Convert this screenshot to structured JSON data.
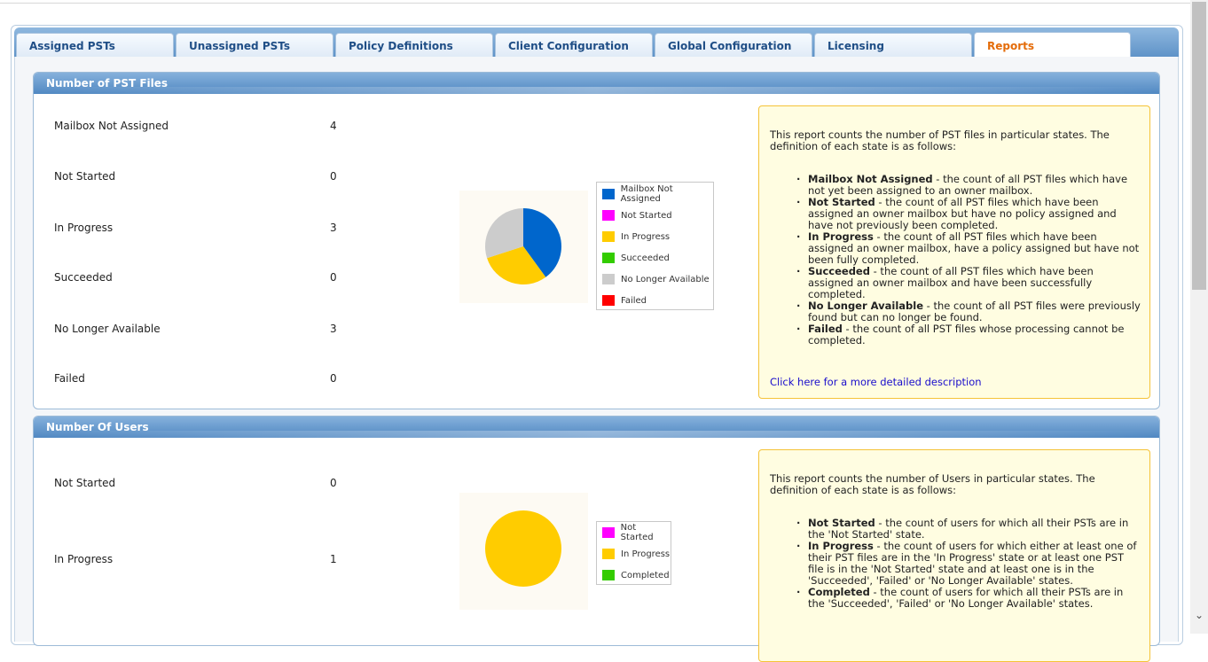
{
  "tabs": [
    {
      "label": "Assigned PSTs"
    },
    {
      "label": "Unassigned PSTs"
    },
    {
      "label": "Policy Definitions"
    },
    {
      "label": "Client Configuration"
    },
    {
      "label": "Global Configuration"
    },
    {
      "label": "Licensing"
    },
    {
      "label": "Reports",
      "active": true
    }
  ],
  "pst_panel": {
    "title": "Number of PST Files",
    "stats": [
      {
        "label": "Mailbox Not Assigned",
        "value": "4"
      },
      {
        "label": "Not Started",
        "value": "0"
      },
      {
        "label": "In Progress",
        "value": "3"
      },
      {
        "label": "Succeeded",
        "value": "0"
      },
      {
        "label": "No Longer Available",
        "value": "3"
      },
      {
        "label": "Failed",
        "value": "0"
      }
    ],
    "legend": [
      {
        "label": "Mailbox Not Assigned",
        "color": "#0066cc"
      },
      {
        "label": "Not Started",
        "color": "#ff00ff"
      },
      {
        "label": "In Progress",
        "color": "#ffcc00"
      },
      {
        "label": "Succeeded",
        "color": "#33cc00"
      },
      {
        "label": "No Longer Available",
        "color": "#cccccc"
      },
      {
        "label": "Failed",
        "color": "#ff0000"
      }
    ],
    "info": {
      "intro": "This report counts the number of PST files in particular states. The definition of each state is as follows:",
      "items": [
        {
          "term": "Mailbox Not Assigned",
          "desc": " - the count of all PST files which have not yet been assigned to an owner mailbox."
        },
        {
          "term": "Not Started",
          "desc": " - the count of all PST files which have been assigned an owner mailbox but have no policy assigned and have not previously been completed."
        },
        {
          "term": "In Progress",
          "desc": " - the count of all PST files which have been assigned an owner mailbox, have a policy assigned but have not been fully completed."
        },
        {
          "term": "Succeeded",
          "desc": " - the count of all PST files which have been assigned an owner mailbox and have been successfully completed."
        },
        {
          "term": "No Longer Available",
          "desc": " - the count of all PST files were previously found but can no longer be found."
        },
        {
          "term": "Failed",
          "desc": " - the count of all PST files whose processing cannot be completed."
        }
      ],
      "link": "Click here for a more detailed description"
    }
  },
  "users_panel": {
    "title": "Number Of Users",
    "stats": [
      {
        "label": "Not Started",
        "value": "0"
      },
      {
        "label": "In Progress",
        "value": "1"
      }
    ],
    "legend": [
      {
        "label": "Not Started",
        "color": "#ff00ff"
      },
      {
        "label": "In Progress",
        "color": "#ffcc00"
      },
      {
        "label": "Completed",
        "color": "#33cc00"
      }
    ],
    "info": {
      "intro": "This report counts the number of Users in particular states. The definition of each state is as follows:",
      "items": [
        {
          "term": "Not Started",
          "desc": " - the count of users for which all their PSTs are in the 'Not Started' state."
        },
        {
          "term": "In Progress",
          "desc": " - the count of users for which either at least one of their PST files are in the 'In Progress' state or at least one PST file is in the 'Not Started' state and at least one is in the 'Succeeded', 'Failed' or 'No Longer Available' states."
        },
        {
          "term": "Completed",
          "desc": " - the count of users for which all their PSTs are in the 'Succeeded', 'Failed' or 'No Longer Available' states."
        }
      ]
    }
  },
  "chart_data": [
    {
      "type": "pie",
      "categories": [
        "Mailbox Not Assigned",
        "Not Started",
        "In Progress",
        "Succeeded",
        "No Longer Available",
        "Failed"
      ],
      "values": [
        4,
        0,
        3,
        0,
        3,
        0
      ],
      "colors": [
        "#0066cc",
        "#ff00ff",
        "#ffcc00",
        "#33cc00",
        "#cccccc",
        "#ff0000"
      ],
      "legend": "right"
    },
    {
      "type": "pie",
      "categories": [
        "Not Started",
        "In Progress",
        "Completed"
      ],
      "values": [
        0,
        1,
        0
      ],
      "colors": [
        "#ff00ff",
        "#ffcc00",
        "#33cc00"
      ],
      "legend": "right"
    }
  ]
}
